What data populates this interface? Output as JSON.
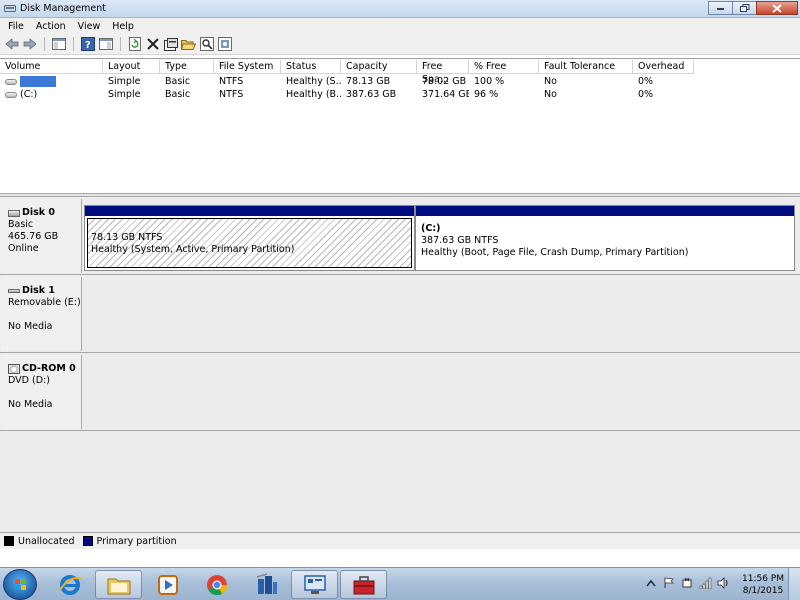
{
  "window": {
    "title": "Disk Management"
  },
  "menu": [
    "File",
    "Action",
    "View",
    "Help"
  ],
  "volume_list": {
    "columns": [
      "Volume",
      "Layout",
      "Type",
      "File System",
      "Status",
      "Capacity",
      "Free Spa...",
      "% Free",
      "Fault Tolerance",
      "Overhead"
    ],
    "rows": [
      {
        "volume": "",
        "layout": "Simple",
        "type": "Basic",
        "fs": "NTFS",
        "status": "Healthy (S...",
        "capacity": "78.13 GB",
        "free": "78.02 GB",
        "pct": "100 %",
        "fault": "No",
        "overhead": "0%"
      },
      {
        "volume": "(C:)",
        "layout": "Simple",
        "type": "Basic",
        "fs": "NTFS",
        "status": "Healthy (B...",
        "capacity": "387.63 GB",
        "free": "371.64 GB",
        "pct": "96 %",
        "fault": "No",
        "overhead": "0%"
      }
    ]
  },
  "disks": [
    {
      "name": "Disk 0",
      "lines": [
        "Basic",
        "465.76 GB",
        "Online"
      ],
      "partitions": [
        {
          "label": "",
          "size": "78.13 GB NTFS",
          "status": "Healthy (System, Active, Primary Partition)"
        },
        {
          "label": "(C:)",
          "size": "387.63 GB NTFS",
          "status": "Healthy (Boot, Page File, Crash Dump, Primary Partition)"
        }
      ]
    },
    {
      "name": "Disk 1",
      "line1": "Removable (E:)",
      "line2": "No Media"
    },
    {
      "name": "CD-ROM 0",
      "line1": "DVD (D:)",
      "line2": "No Media"
    }
  ],
  "legend": [
    {
      "label": "Unallocated",
      "color": "#000000"
    },
    {
      "label": "Primary partition",
      "color": "#000c80"
    }
  ],
  "taskbar": {
    "apps": [
      "internet-explorer",
      "windows-explorer",
      "media-player",
      "chrome",
      "network-app",
      "remote-desktop",
      "toolbox"
    ],
    "time": "11:56 PM",
    "date": "8/1/2015"
  }
}
